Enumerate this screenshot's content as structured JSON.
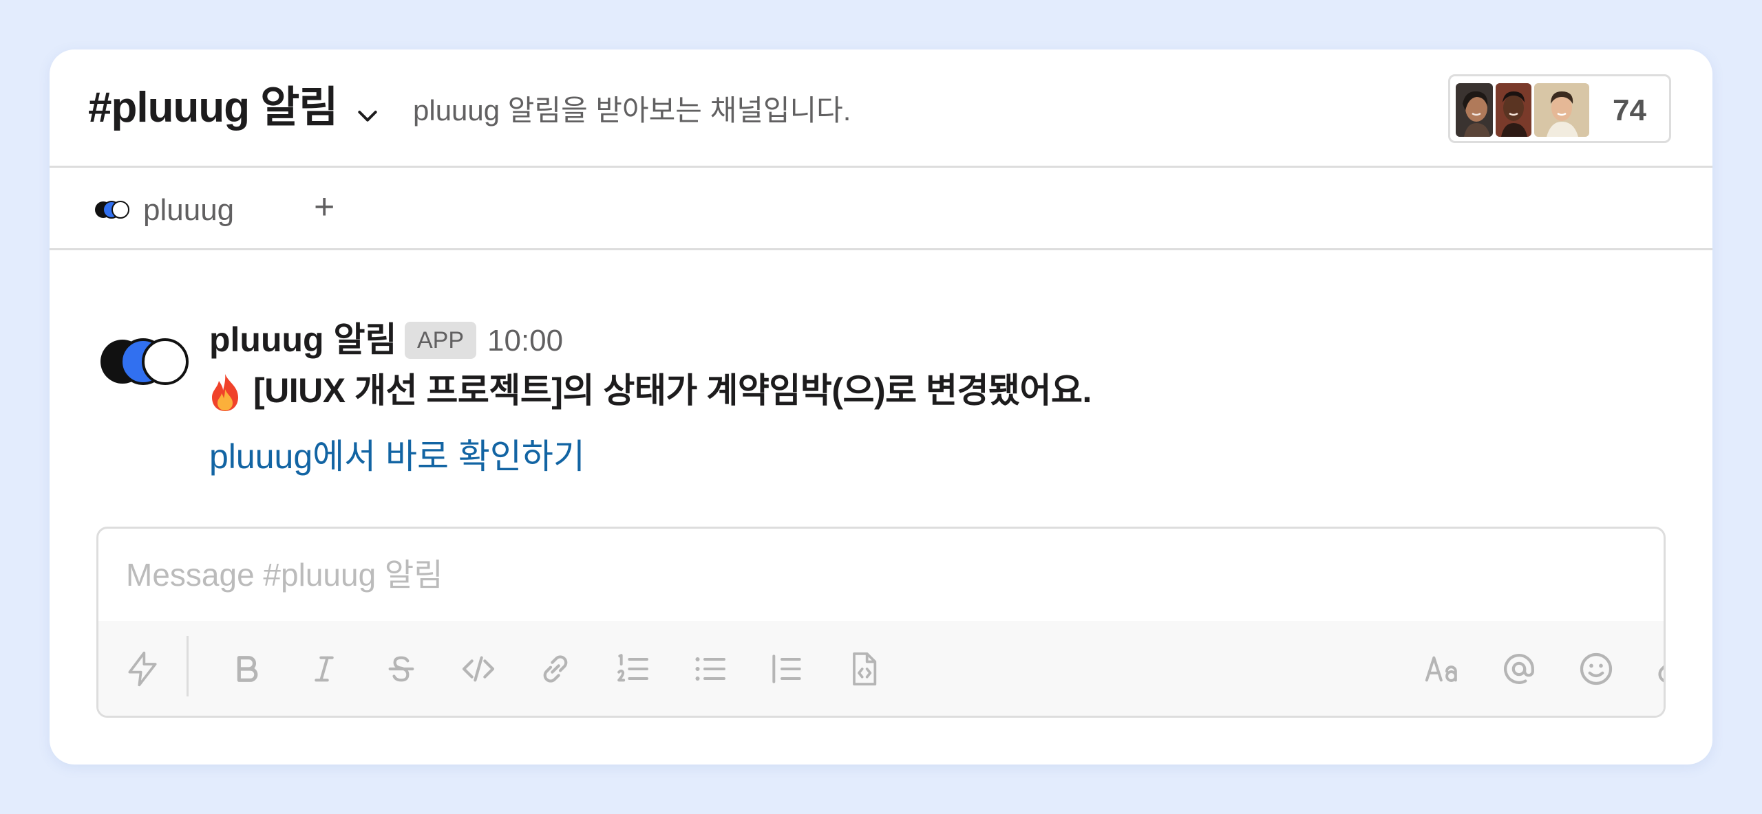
{
  "channel": {
    "title": "#pluuug 알림",
    "description": "pluuug 알림을 받아보는 채널입니다.",
    "member_count": "74"
  },
  "tabs": [
    {
      "label": "pluuug"
    }
  ],
  "tab_add_label": "+",
  "message": {
    "author": "pluuug 알림",
    "badge": "APP",
    "time": "10:00",
    "text": "[UIUX 개선 프로젝트]의 상태가 계약임박(으)로 변경됐어요.",
    "link_text": "pluuug에서 바로 확인하기"
  },
  "composer": {
    "placeholder": "Message #pluuug 알림"
  },
  "toolbar": {
    "icons": [
      "shortcuts-icon",
      "bold-icon",
      "italic-icon",
      "strikethrough-icon",
      "code-icon",
      "link-icon",
      "ordered-list-icon",
      "bulleted-list-icon",
      "blockquote-icon",
      "code-block-icon",
      "formatting-icon",
      "mention-icon",
      "emoji-icon",
      "attachment-icon"
    ]
  },
  "colors": {
    "background": "#e3ecfd",
    "link": "#1264a3",
    "brand_blue": "#3170f0",
    "text": "#1d1c1d"
  }
}
